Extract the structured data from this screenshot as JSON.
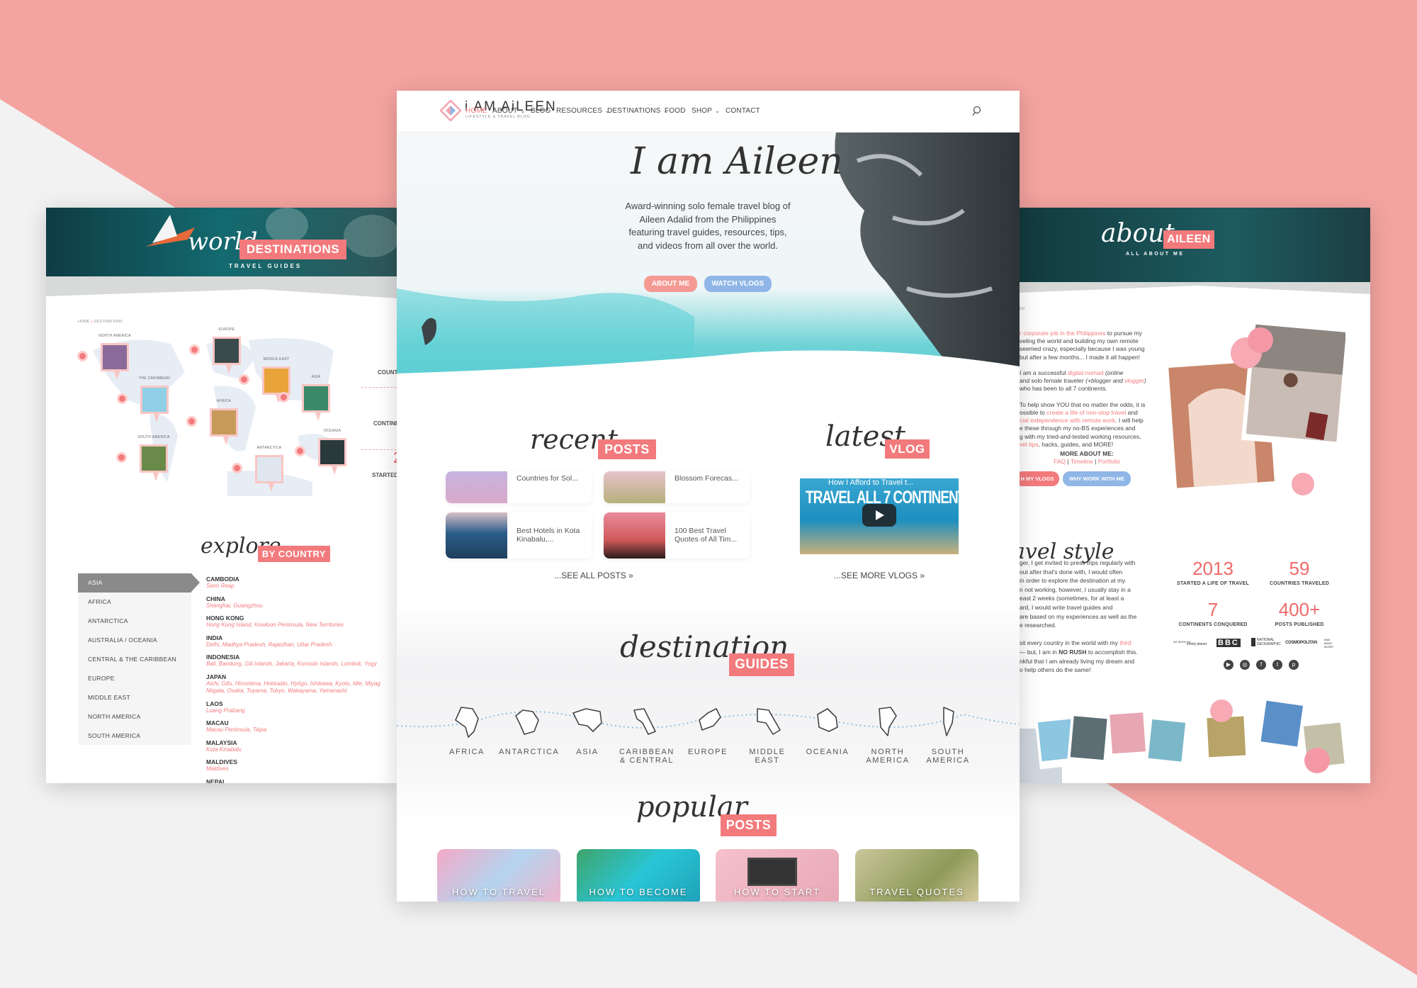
{
  "colors": {
    "background_pink": "#f4a4a0",
    "background_gray": "#f2f2f3",
    "accent": "#f37a7c",
    "button_blue": "#8fb6e6",
    "button_coral": "#f49a93"
  },
  "center": {
    "logo": {
      "name": "i AM AiLEEN",
      "tagline": "LIFESTYLE & TRAVEL BLOG",
      "icon": "diamond-logo-icon"
    },
    "nav": [
      {
        "label": "HOME",
        "active": true
      },
      {
        "label": "ABOUT",
        "dropdown": true
      },
      {
        "label": "BLOG"
      },
      {
        "label": "RESOURCES",
        "dropdown": true
      },
      {
        "label": "DESTINATIONS",
        "dropdown": true
      },
      {
        "label": "FOOD"
      },
      {
        "label": "SHOP",
        "dropdown": true
      },
      {
        "label": "CONTACT"
      }
    ],
    "search_icon": "search-icon",
    "hero": {
      "script": "I am Aileen",
      "description": "Award-winning solo female travel blog of Aileen Adalid from the Philippines featuring travel guides, resources, tips, and videos from all over the world.",
      "buttons": [
        "ABOUT ME",
        "WATCH VLOGS"
      ]
    },
    "recent": {
      "script": "recent",
      "badge": "POSTS",
      "posts": [
        "Countries for Sol...",
        "Blossom Forecas...",
        "Best Hotels in Kota Kinabalu,...",
        "100 Best Travel Quotes of All Tim..."
      ],
      "see_all": "...SEE ALL POSTS »"
    },
    "vlog": {
      "script": "latest",
      "badge": "VLOG",
      "video_title": "How I Afford to Travel t...",
      "video_overlay": "TRAVEL ALL 7 CONTINENTS!",
      "see_more": "...SEE MORE VLOGS »"
    },
    "guides": {
      "script": "destination",
      "badge": "GUIDES",
      "continents": [
        "AFRICA",
        "ANTARCTICA",
        "ASIA",
        "CARIBBEAN & CENTRAL",
        "EUROPE",
        "MIDDLE EAST",
        "OCEANIA",
        "NORTH AMERICA",
        "SOUTH AMERICA"
      ]
    },
    "popular": {
      "script": "popular",
      "badge": "POSTS",
      "cards": [
        "HOW TO TRAVEL",
        "HOW TO BECOME",
        "HOW TO START",
        "TRAVEL QUOTES"
      ]
    }
  },
  "left": {
    "header": {
      "script": "world",
      "badge": "DESTINATIONS",
      "sub": "TRAVEL GUIDES"
    },
    "breadcrumb": {
      "home": "HOME",
      "sep": "»",
      "current": "DESTINATIONS"
    },
    "pins": [
      "NORTH AMERICA",
      "EUROPE",
      "MIDDLE EAST",
      "THE CARIBBEAN",
      "ASIA",
      "AFRICA",
      "SOUTH AMERICA",
      "ANTARCTICA",
      "OCEANIA"
    ],
    "side_labels": [
      "COUNT",
      "CONTINE",
      "2",
      "STARTED"
    ],
    "explore": {
      "script": "explore",
      "badge": "BY COUNTRY"
    },
    "regions": [
      "ASIA",
      "AFRICA",
      "ANTARCTICA",
      "AUSTRALIA / OCEANIA",
      "CENTRAL & THE CARIBBEAN",
      "EUROPE",
      "MIDDLE EAST",
      "NORTH AMERICA",
      "SOUTH AMERICA"
    ],
    "countries": [
      {
        "name": "CAMBODIA",
        "cities": [
          "Siem Reap"
        ]
      },
      {
        "name": "CHINA",
        "cities": [
          "Shanghai, Guangzhou"
        ]
      },
      {
        "name": "HONG KONG",
        "cities": [
          "Hong Kong Island, Kowloon Peninsula, New Territories"
        ]
      },
      {
        "name": "INDIA",
        "cities": [
          "Delhi, Madhya Pradesh, Rajasthan, Uttar Pradesh"
        ]
      },
      {
        "name": "INDONESIA",
        "cities": [
          "Bali, Bandung, Gili Islands, Jakarta, Komodo Islands, Lombok, Yogy"
        ]
      },
      {
        "name": "JAPAN",
        "cities": [
          "Aichi, Gifu, Hiroshima, Hokkaido, Hyōgo, Ishikawa, Kyoto, Mie, Miyag",
          "Niigata, Osaka, Toyama, Tokyo, Wakayama, Yamanashi"
        ]
      },
      {
        "name": "LAOS",
        "cities": [
          "Luang Prabang"
        ]
      },
      {
        "name": "MACAU",
        "cities": [
          "Macau Peninsula, Taipa"
        ]
      },
      {
        "name": "MALAYSIA",
        "cities": [
          "Kota Kinabalu"
        ]
      },
      {
        "name": "MALDIVES",
        "cities": [
          "Maldives"
        ]
      },
      {
        "name": "NEPAL",
        "cities": []
      }
    ]
  },
  "right": {
    "header": {
      "script": "about",
      "badge": "AILEEN",
      "sub": "ALL ABOUT ME"
    },
    "crumb": "EN",
    "about_lines": [
      [
        {
          "t": "r corporate job in the Philippines",
          "s": "link"
        },
        {
          "t": " to pursue my"
        }
      ],
      [
        {
          "t": "veling the world and building my own remote"
        }
      ],
      [
        {
          "t": "seemed crazy, especially because I was young"
        }
      ],
      [
        {
          "t": "but after a few months... I made it all happen!"
        }
      ],
      [],
      [
        {
          "t": "I am a successful "
        },
        {
          "t": "digital nomad",
          "s": "link"
        },
        {
          "t": " (online",
          "s": "i"
        }
      ],
      [
        {
          "t": "and solo female traveler "
        },
        {
          "t": "(+blogger and ",
          "s": "i"
        },
        {
          "t": "vlogger",
          "s": "link i"
        },
        {
          "t": ")",
          "s": "i"
        }
      ],
      [
        {
          "t": "who has been to all 7 continents."
        }
      ],
      [],
      [
        {
          "t": "To help show YOU that no matter the odds, it is"
        }
      ],
      [
        {
          "t": "ossible to "
        },
        {
          "t": "create a life of non-stop travel",
          "s": "link"
        },
        {
          "t": " and"
        }
      ],
      [
        {
          "t": "cial independence with remote work",
          "s": "link"
        },
        {
          "t": ". I will help"
        }
      ],
      [
        {
          "t": "e these through my no-BS experiences and"
        }
      ],
      [
        {
          "t": "g with my tried-and-tested working resources,"
        }
      ],
      [
        {
          "t": "vel tips",
          "s": "link"
        },
        {
          "t": ", hacks, guides, and MORE!"
        }
      ]
    ],
    "more_about": {
      "title": "MORE ABOUT ME:",
      "links": [
        "FAQ",
        "Timeline",
        "Portfolio"
      ],
      "sep": "|"
    },
    "buttons": [
      "H MY VLOGS",
      "WHY WORK WITH ME"
    ],
    "style_script": "avel style",
    "style_lines": [
      [
        {
          "t": "ger, I get invited to press trips regularly with"
        }
      ],
      [
        {
          "t": "out after that's done with, I would often"
        }
      ],
      [
        {
          "t": "in order to explore the destination at my"
        }
      ],
      [
        {
          "t": "n not working, however, I usually stay in a"
        }
      ],
      [
        {
          "t": "east 2 weeks (sometimes, for at least a"
        }
      ],
      [
        {
          "t": "ard, I would write travel guides and"
        }
      ],
      [
        {
          "t": "are based on my experiences as well as the"
        }
      ],
      [
        {
          "t": "e researched."
        }
      ],
      [],
      [
        {
          "t": "sit every country in the world with my "
        },
        {
          "t": "third",
          "s": "link"
        }
      ],
      [
        {
          "t": "— but, I am in "
        },
        {
          "t": "NO RUSH",
          "s": "b"
        },
        {
          "t": " to accomplish this."
        }
      ],
      [
        {
          "t": "nkful that I am already living my dream and"
        }
      ],
      [
        {
          "t": "o help others do the same!"
        }
      ]
    ],
    "stats": [
      {
        "value": "2013",
        "label": "STARTED A LIFE OF TRAVEL"
      },
      {
        "value": "59",
        "label": "COUNTRIES TRAVELED"
      },
      {
        "value": "7",
        "label": "CONTINENTS CONQUERED"
      },
      {
        "value": "400+",
        "label": "POSTS PUBLISHED"
      }
    ],
    "logos": [
      "AS SEEN ON",
      "lonely planet",
      "BBC",
      "NATIONAL GEOGRAPHIC",
      "COSMOPOLITAN",
      "AND MANY MORE!"
    ],
    "social": [
      "youtube-icon",
      "instagram-icon",
      "facebook-icon",
      "twitter-icon",
      "pinterest-icon"
    ]
  }
}
